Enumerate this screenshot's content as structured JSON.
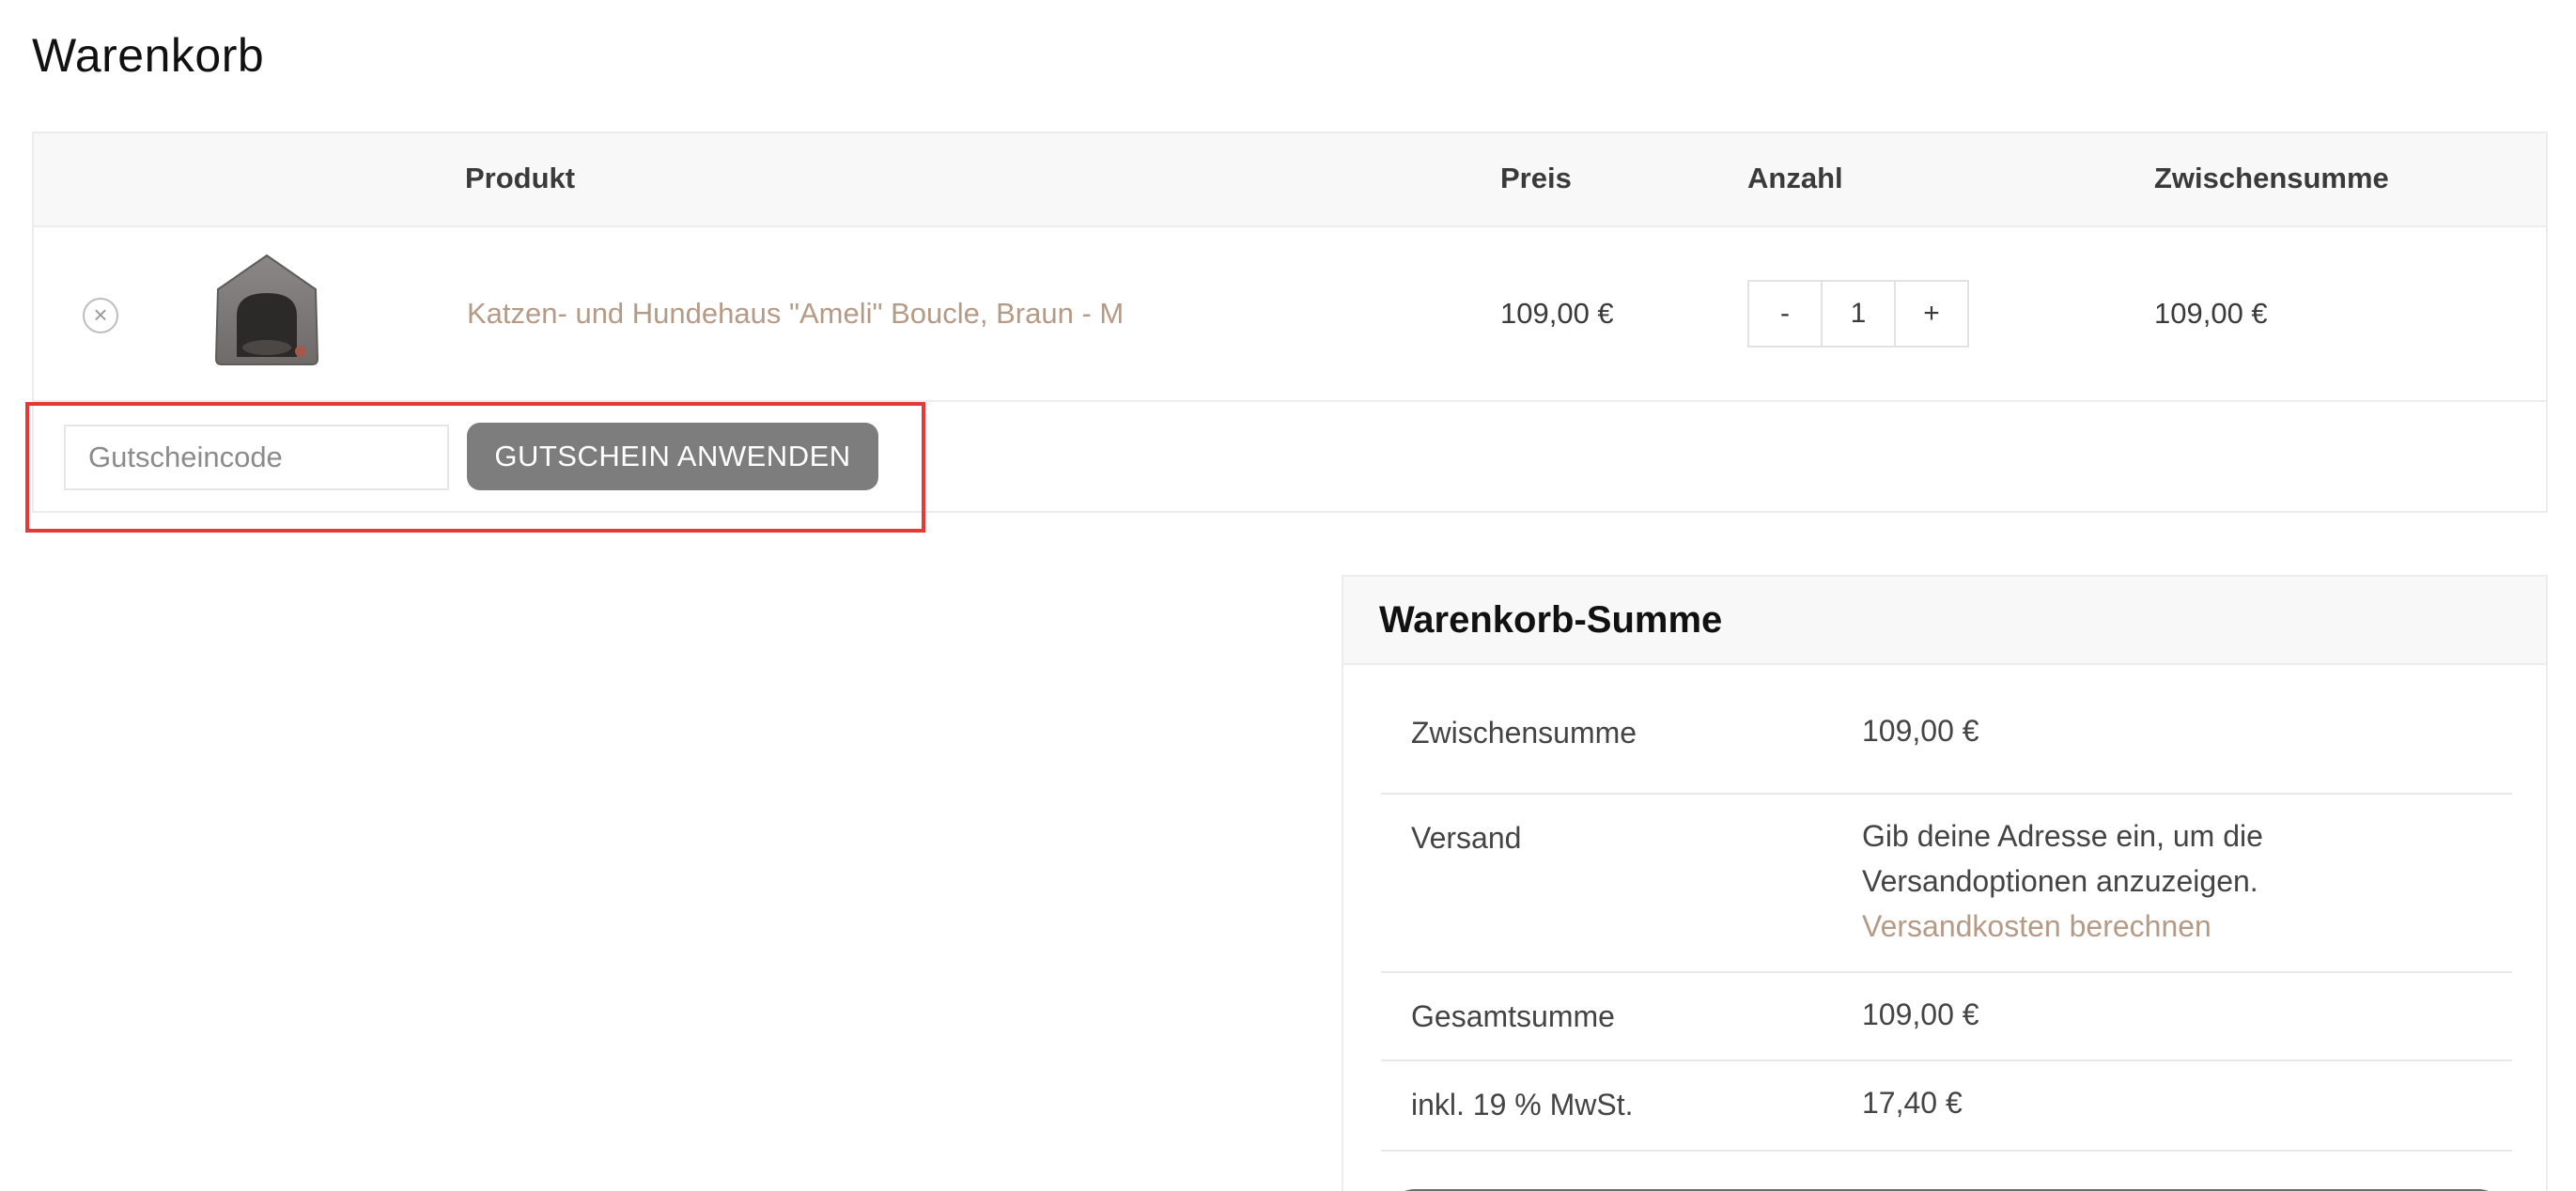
{
  "page": {
    "title": "Warenkorb"
  },
  "cart": {
    "headers": {
      "product": "Produkt",
      "price": "Preis",
      "quantity": "Anzahl",
      "subtotal": "Zwischensumme"
    },
    "items": [
      {
        "name": "Katzen- und Hundehaus \"Ameli\" Boucle, Braun - M",
        "price": "109,00 €",
        "quantity": "1",
        "subtotal": "109,00 €",
        "remove_icon": "×",
        "minus_label": "-",
        "plus_label": "+"
      }
    ],
    "coupon": {
      "placeholder": "Gutscheincode",
      "value": "",
      "button_label": "GUTSCHEIN ANWENDEN"
    }
  },
  "totals": {
    "title": "Warenkorb-Summe",
    "subtotal_label": "Zwischensumme",
    "subtotal_value": "109,00 €",
    "shipping_label": "Versand",
    "shipping_text_line1": "Gib deine Adresse ein, um die",
    "shipping_text_line2": "Versandoptionen anzuzeigen.",
    "shipping_link": "Versandkosten berechnen",
    "total_label": "Gesamtsumme",
    "total_value": "109,00 €",
    "tax_label": "inkl. 19 % MwSt.",
    "tax_value": "17,40 €"
  },
  "colors": {
    "link": "#b59a86",
    "button": "#7d7d7d",
    "highlight": "#e53935",
    "header_bg": "#f8f8f8"
  }
}
